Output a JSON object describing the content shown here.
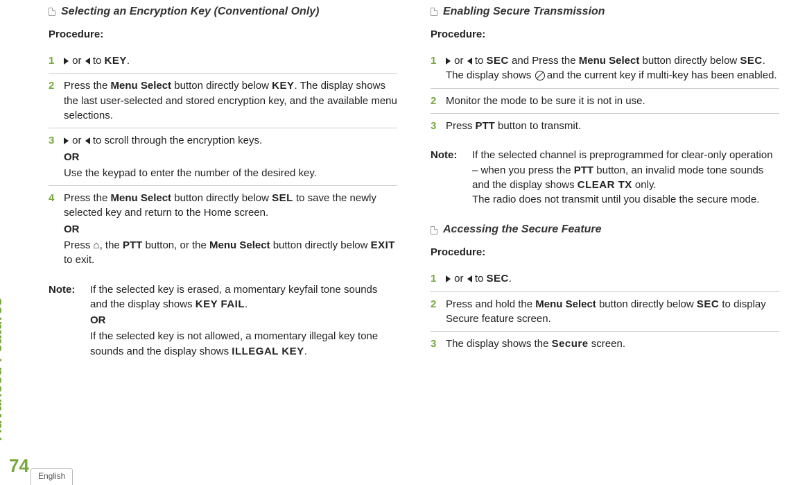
{
  "side_label": "Advanced Features",
  "page_number": "74",
  "lang_tab": "English",
  "tokens": {
    "or": "or",
    "or_caps": "OR",
    "to": "to",
    "note": "Note:",
    "procedure": "Procedure:"
  },
  "left": {
    "section1": {
      "title": "Selecting an Encryption Key (Conventional Only)",
      "steps": [
        {
          "num": "1",
          "pre": "",
          "mono1": "KEY",
          "post": "."
        },
        {
          "num": "2",
          "t1": "Press the ",
          "b1": "Menu Select",
          "t2": " button directly below ",
          "mono1": "KEY",
          "t3": ". The display shows the last user-selected and stored encryption key, and the available menu selections."
        },
        {
          "num": "3",
          "line1_tail": " to scroll through the encryption keys.",
          "line2": "Use the keypad to enter the number of the desired key."
        },
        {
          "num": "4",
          "t1": "Press the ",
          "b1": "Menu Select",
          "t2": " button directly below ",
          "mono1": "SEL",
          "t3": " to save the newly selected key and return to the Home screen.",
          "line2_t1": "Press ",
          "line2_b1": "PTT",
          "line2_t2": " button, or the ",
          "line2_b2": "Menu Select",
          "line2_t3": " button directly below ",
          "line2_mono": "EXIT",
          "line2_t4": " to exit.",
          "line2_home_mid": ", the "
        }
      ],
      "note": {
        "p1_t1": "If the selected key is erased, a momentary keyfail tone sounds and the display shows ",
        "p1_mono": "KEY FAIL",
        "p1_t2": ".",
        "p2_t1": "If the selected key is not allowed, a momentary illegal key tone sounds and the display shows ",
        "p2_mono": "ILLEGAL KEY",
        "p2_t2": "."
      }
    }
  },
  "right": {
    "section1": {
      "title": "Enabling Secure Transmission",
      "steps": [
        {
          "num": "1",
          "mono1": "SEC",
          "t1": " and Press the ",
          "b1": "Menu Select",
          "t2": " button directly below ",
          "mono2": "SEC",
          "t3": ". The display shows ",
          "t4": " and the current key if multi-key has been enabled."
        },
        {
          "num": "2",
          "text": "Monitor the mode to be sure it is not in use."
        },
        {
          "num": "3",
          "t1": "Press ",
          "b1": "PTT",
          "t2": " button to transmit."
        }
      ],
      "note": {
        "p1_t1": "If the selected channel is preprogrammed for clear-only operation – when you press the ",
        "p1_b1": "PTT",
        "p1_t2": " button, an invalid mode tone sounds and the display shows ",
        "p1_mono": "CLEAR TX",
        "p1_t3": " only.",
        "p2": "The radio does not transmit until you disable the secure mode."
      }
    },
    "section2": {
      "title": "Accessing the Secure Feature",
      "steps": [
        {
          "num": "1",
          "mono1": "SEC",
          "post": "."
        },
        {
          "num": "2",
          "t1": "Press and hold the ",
          "b1": "Menu Select",
          "t2": " button directly below ",
          "mono1": "SEC",
          "t3": " to display Secure feature screen."
        },
        {
          "num": "3",
          "t1": "The display shows the ",
          "mono1": "Secure",
          "t2": " screen."
        }
      ]
    }
  }
}
